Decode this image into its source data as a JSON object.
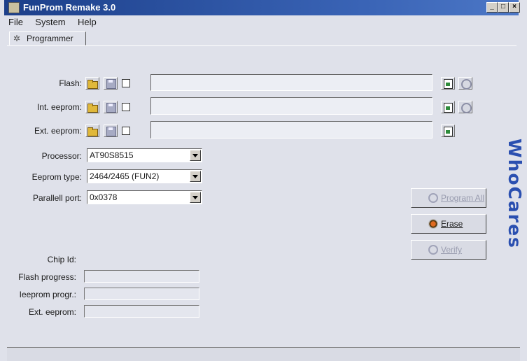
{
  "window": {
    "title": "FunProm Remake 3.0",
    "btn_min": "_",
    "btn_max": "□",
    "btn_close": "×"
  },
  "menu": [
    "File",
    "System",
    "Help"
  ],
  "tab": {
    "label": "Programmer",
    "icon": "gears-icon"
  },
  "memory_rows": [
    {
      "label": "Flash:",
      "checked": false,
      "path": "",
      "has_gear": true
    },
    {
      "label": "Int. eeprom:",
      "checked": false,
      "path": "",
      "has_gear": true
    },
    {
      "label": "Ext. eeprom:",
      "checked": false,
      "path": "",
      "has_gear": false
    }
  ],
  "settings": {
    "processor": {
      "label": "Processor:",
      "value": "AT90S8515"
    },
    "eeprom_type": {
      "label": "Eeprom type:",
      "value": "2464/2465 (FUN2)"
    },
    "parallel_port": {
      "label": "Parallell port:",
      "value": "0x0378"
    }
  },
  "actions": {
    "program_all": {
      "label": "Program All",
      "enabled": false
    },
    "erase": {
      "label": "Erase",
      "enabled": true
    },
    "verify": {
      "label": "Verify",
      "enabled": false
    }
  },
  "status": {
    "chip_id": {
      "label": "Chip Id:"
    },
    "flash_progress": {
      "label": "Flash progress:",
      "progress": 0
    },
    "ieeprom_progress": {
      "label": "Ieeprom progr.:",
      "progress": 0
    },
    "ext_eeprom": {
      "label": "Ext. eeprom:",
      "progress": 0
    }
  },
  "brand": {
    "text": "WhoCares",
    "color": "#2a4fb0"
  }
}
